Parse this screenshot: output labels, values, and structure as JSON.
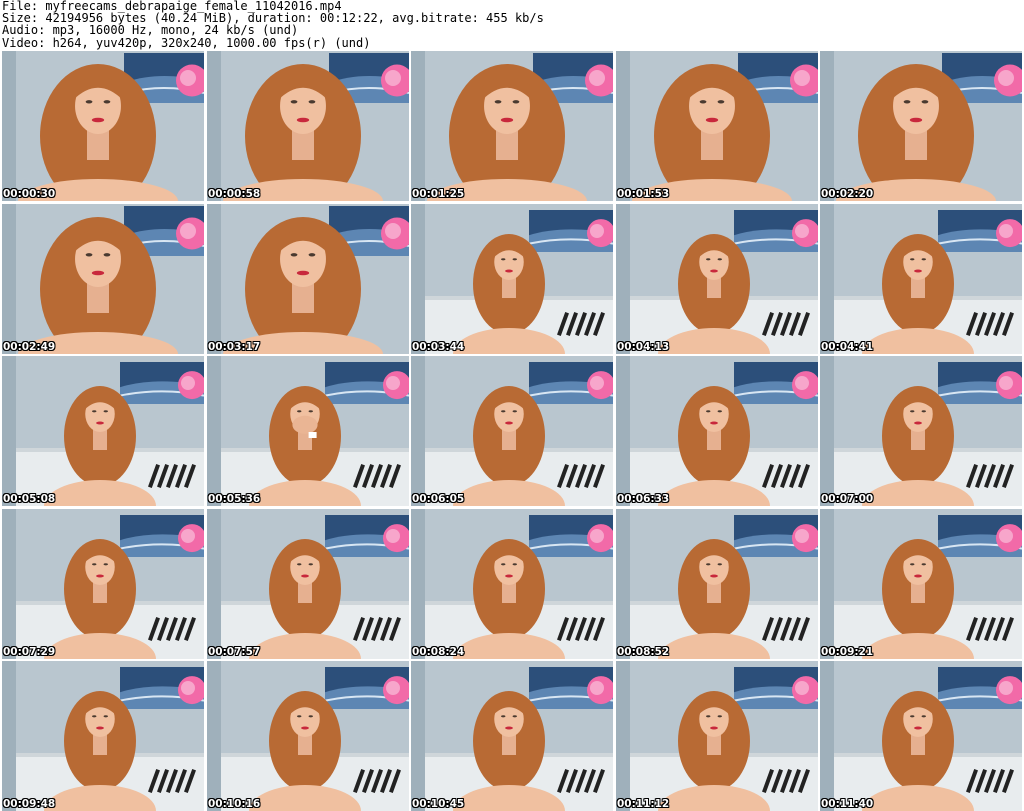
{
  "header": {
    "file_line": "File: myfreecams_debrapaige_female_11042016.mp4",
    "size_line": "Size: 42194956 bytes (40.24 MiB), duration: 00:12:22, avg.bitrate: 455 kb/s",
    "audio_line": "Audio: mp3, 16000 Hz, mono, 24 kb/s (und)",
    "video_line": "Video: h264, yuv420p, 320x240, 1000.00 fps(r) (und)"
  },
  "thumbnails": [
    {
      "timestamp": "00:00:30",
      "variant": "closeup"
    },
    {
      "timestamp": "00:00:58",
      "variant": "closeup"
    },
    {
      "timestamp": "00:01:25",
      "variant": "closeup"
    },
    {
      "timestamp": "00:01:53",
      "variant": "closeup"
    },
    {
      "timestamp": "00:02:20",
      "variant": "closeup"
    },
    {
      "timestamp": "00:02:49",
      "variant": "closeup"
    },
    {
      "timestamp": "00:03:17",
      "variant": "closeup"
    },
    {
      "timestamp": "00:03:44",
      "variant": "room"
    },
    {
      "timestamp": "00:04:13",
      "variant": "room"
    },
    {
      "timestamp": "00:04:41",
      "variant": "room"
    },
    {
      "timestamp": "00:05:08",
      "variant": "room"
    },
    {
      "timestamp": "00:05:36",
      "variant": "hands"
    },
    {
      "timestamp": "00:06:05",
      "variant": "room"
    },
    {
      "timestamp": "00:06:33",
      "variant": "room"
    },
    {
      "timestamp": "00:07:00",
      "variant": "room"
    },
    {
      "timestamp": "00:07:29",
      "variant": "room"
    },
    {
      "timestamp": "00:07:57",
      "variant": "room"
    },
    {
      "timestamp": "00:08:24",
      "variant": "room"
    },
    {
      "timestamp": "00:08:52",
      "variant": "room"
    },
    {
      "timestamp": "00:09:21",
      "variant": "room"
    },
    {
      "timestamp": "00:09:48",
      "variant": "room"
    },
    {
      "timestamp": "00:10:16",
      "variant": "room"
    },
    {
      "timestamp": "00:10:45",
      "variant": "room"
    },
    {
      "timestamp": "00:11:12",
      "variant": "room"
    },
    {
      "timestamp": "00:11:40",
      "variant": "room"
    }
  ],
  "colors": {
    "wall": "#b9c6cf",
    "painting": "#2c4f7a",
    "flower": "#f26aa8",
    "hair": "#b86a34",
    "skin": "#f0c0a0",
    "headboard": "#e8ecee",
    "zebra": "#222222"
  }
}
